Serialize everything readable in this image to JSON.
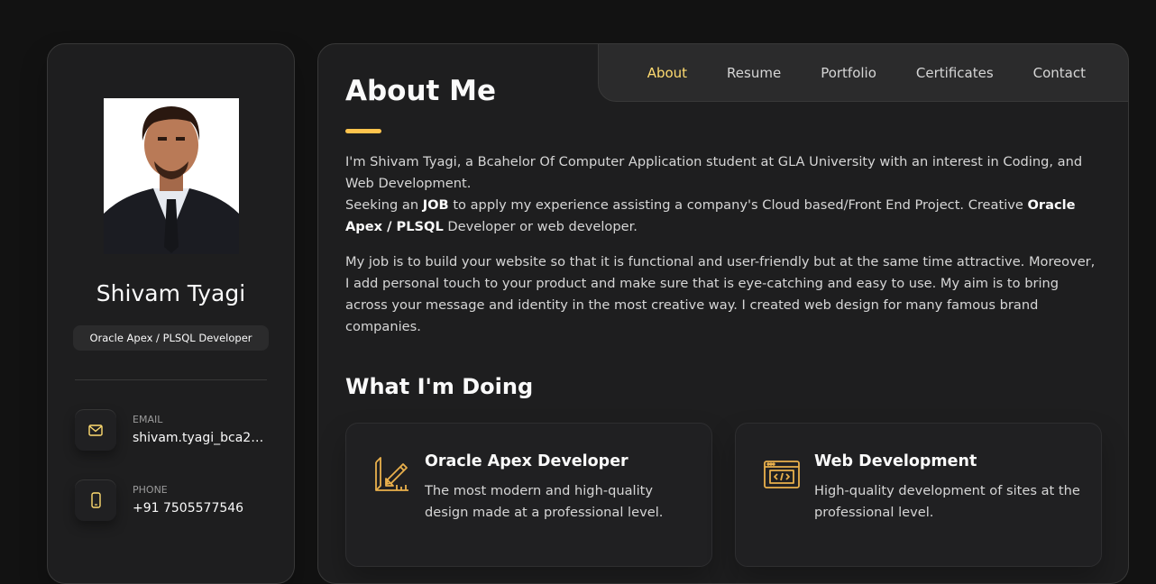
{
  "sidebar": {
    "name": "Shivam Tyagi",
    "title": "Oracle Apex / PLSQL Developer",
    "contacts": [
      {
        "label": "EMAIL",
        "value": "shivam.tyagi_bca21...",
        "icon": "mail-icon"
      },
      {
        "label": "PHONE",
        "value": "+91 7505577546",
        "icon": "phone-icon"
      }
    ]
  },
  "nav": {
    "items": [
      "About",
      "Resume",
      "Portfolio",
      "Certificates",
      "Contact"
    ],
    "active": "About"
  },
  "about": {
    "heading": "About Me",
    "p1_a": "I'm Shivam Tyagi, a Bcahelor Of Computer Application student at GLA University with an interest in Coding, and Web Development.",
    "p1_b": "Seeking an ",
    "p1_job": "JOB",
    "p1_c": " to apply my experience assisting a company's Cloud based/Front End Project. Creative ",
    "p1_oracle": "Oracle Apex / PLSQL",
    "p1_d": " Developer or web developer.",
    "p2": "My job is to build your website so that it is functional and user-friendly but at the same time attractive. Moreover, I add personal touch to your product and make sure that is eye-catching and easy to use. My aim is to bring across your message and identity in the most creative way. I created web design for many famous brand companies."
  },
  "services": {
    "heading": "What I'm Doing",
    "items": [
      {
        "title": "Oracle Apex Developer",
        "text": "The most modern and high-quality design made at a professional level.",
        "icon": "design-icon"
      },
      {
        "title": "Web Development",
        "text": "High-quality development of sites at the professional level.",
        "icon": "code-icon"
      }
    ]
  },
  "colors": {
    "accent": "#ffdb70",
    "bg": "#121212",
    "card": "#1e1e1f"
  }
}
